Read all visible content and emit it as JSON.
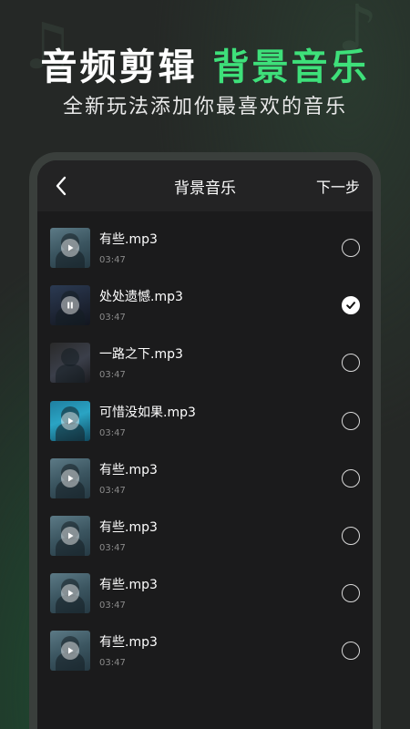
{
  "promo": {
    "headline_white": "音频剪辑",
    "headline_green": "背景音乐",
    "subline": "全新玩法添加你最喜欢的音乐"
  },
  "header": {
    "back_icon": "chevron-left-icon",
    "title": "背景音乐",
    "next_label": "下一步"
  },
  "songs": [
    {
      "name": "有些.mp3",
      "duration": "03:47",
      "selected": false,
      "state": "play"
    },
    {
      "name": "处处遗憾.mp3",
      "duration": "03:47",
      "selected": true,
      "state": "pause"
    },
    {
      "name": "一路之下.mp3",
      "duration": "03:47",
      "selected": false,
      "state": "none"
    },
    {
      "name": "可惜没如果.mp3",
      "duration": "03:47",
      "selected": false,
      "state": "play"
    },
    {
      "name": "有些.mp3",
      "duration": "03:47",
      "selected": false,
      "state": "play"
    },
    {
      "name": "有些.mp3",
      "duration": "03:47",
      "selected": false,
      "state": "play"
    },
    {
      "name": "有些.mp3",
      "duration": "03:47",
      "selected": false,
      "state": "play"
    },
    {
      "name": "有些.mp3",
      "duration": "03:47",
      "selected": false,
      "state": "play"
    }
  ],
  "colors": {
    "accent_green": "#3ee07a",
    "background": "#252826",
    "panel": "#1b1b1c"
  }
}
